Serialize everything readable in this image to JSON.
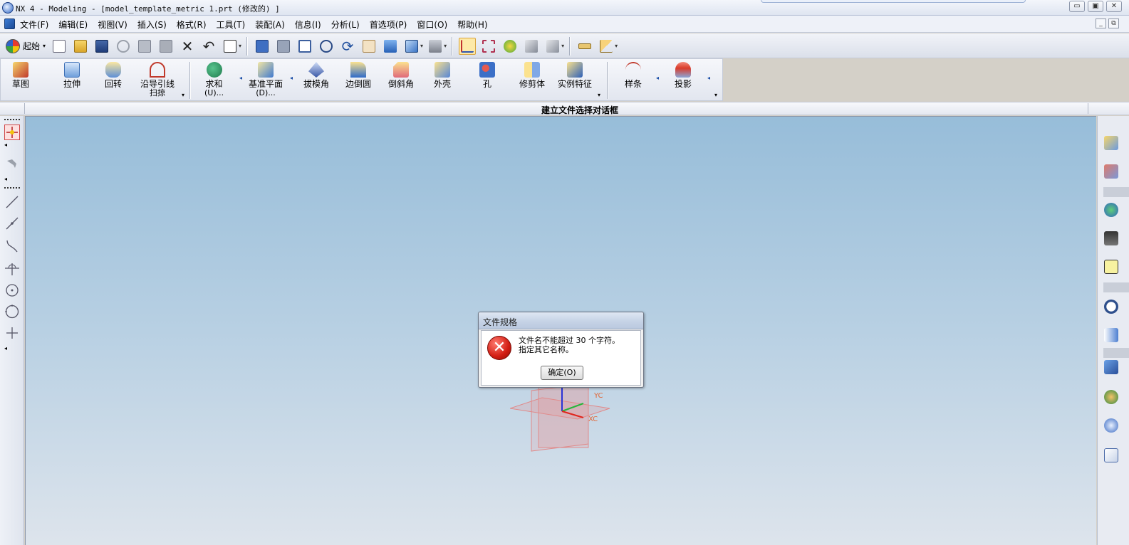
{
  "titlebar": {
    "title": "NX 4 - Modeling - [model_template_metric 1.prt (修改的) ]",
    "window_buttons": [
      "▭",
      "▣",
      "✕"
    ]
  },
  "menubar": {
    "items": [
      "文件(F)",
      "编辑(E)",
      "视图(V)",
      "插入(S)",
      "格式(R)",
      "工具(T)",
      "装配(A)",
      "信息(I)",
      "分析(L)",
      "首选项(P)",
      "窗口(O)",
      "帮助(H)"
    ],
    "mdi_buttons": [
      "_",
      "⧉"
    ]
  },
  "toolbar1": {
    "start_label": "起始",
    "tools": [
      "new-file-icon",
      "open-folder-icon",
      "save-icon",
      "cut-icon",
      "copy-icon",
      "paste-icon",
      "delete-icon",
      "undo-icon",
      "info-icon",
      "fit-icon",
      "zoom-window-icon",
      "zoom-box-icon",
      "zoom-icon",
      "rotate-icon",
      "pan-icon",
      "shaded-icon",
      "view-cube-icon",
      "render-icon",
      "wcs-icon",
      "snap-icon",
      "analysis-icon",
      "measure-distance-icon",
      "measure-angle-icon",
      "ruler-icon",
      "protractor-icon"
    ]
  },
  "toolbar2": {
    "tools": [
      {
        "label": "草图",
        "sub": ""
      },
      {
        "label": "拉伸",
        "sub": ""
      },
      {
        "label": "回转",
        "sub": ""
      },
      {
        "label": "沿导引线",
        "sub": "扫掠"
      },
      {
        "label": "求和",
        "sub": "(U)..."
      },
      {
        "label": "基准平面",
        "sub": "(D)..."
      },
      {
        "label": "拔模角",
        "sub": ""
      },
      {
        "label": "边倒圆",
        "sub": ""
      },
      {
        "label": "倒斜角",
        "sub": ""
      },
      {
        "label": "外壳",
        "sub": ""
      },
      {
        "label": "孔",
        "sub": ""
      },
      {
        "label": "修剪体",
        "sub": ""
      },
      {
        "label": "实例特征",
        "sub": ""
      },
      {
        "label": "样条",
        "sub": ""
      },
      {
        "label": "投影",
        "sub": ""
      }
    ]
  },
  "cuebar": {
    "cue_text": "建立文件选择对话框"
  },
  "viewport": {
    "axis_y": "YC",
    "axis_x": "XC"
  },
  "dialog": {
    "title": "文件规格",
    "message_line1": "文件名不能超过 30 个字符。",
    "message_line2": "指定其它名称。",
    "ok_label": "确定(O)"
  },
  "colors": {
    "viewport_top": "#97bdd9",
    "viewport_bottom": "#dde4ec",
    "error_red": "#d21c12",
    "datum_plane": "#e88f8f"
  }
}
